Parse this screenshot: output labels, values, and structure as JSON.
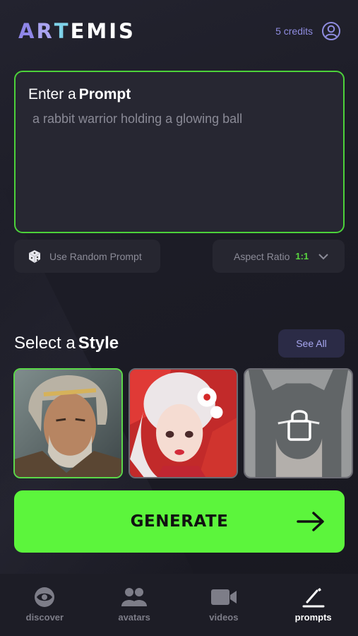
{
  "app": {
    "logo_letters": [
      "A",
      "R",
      "T"
    ],
    "logo_rest": "EMIS"
  },
  "header": {
    "credits": "5 credits",
    "icon": "user-circle-icon"
  },
  "prompt": {
    "title_lead": "Enter a",
    "title_bold": "Prompt",
    "value": "a rabbit warrior holding a glowing ball"
  },
  "controls": {
    "random_label": "Use Random Prompt",
    "aspect_label": "Aspect Ratio",
    "aspect_value": "1:1"
  },
  "styles": {
    "title_lead": "Select a",
    "title_bold": "Style",
    "see_all": "See All",
    "items": [
      {
        "name": "greek-god",
        "selected": true,
        "locked": false
      },
      {
        "name": "anime-geisha",
        "selected": false,
        "locked": false
      },
      {
        "name": "dark-knight",
        "selected": false,
        "locked": true
      }
    ]
  },
  "generate": {
    "label": "GENERATE"
  },
  "tabs": [
    {
      "label": "discover",
      "icon": "eye-icon",
      "active": false
    },
    {
      "label": "avatars",
      "icon": "people-icon",
      "active": false
    },
    {
      "label": "videos",
      "icon": "video-camera-icon",
      "active": false
    },
    {
      "label": "prompts",
      "icon": "pencil-icon",
      "active": true
    }
  ],
  "colors": {
    "accent_green": "#5cf53c",
    "logo_purple": "#8f86e8",
    "background": "#1c1c26"
  }
}
